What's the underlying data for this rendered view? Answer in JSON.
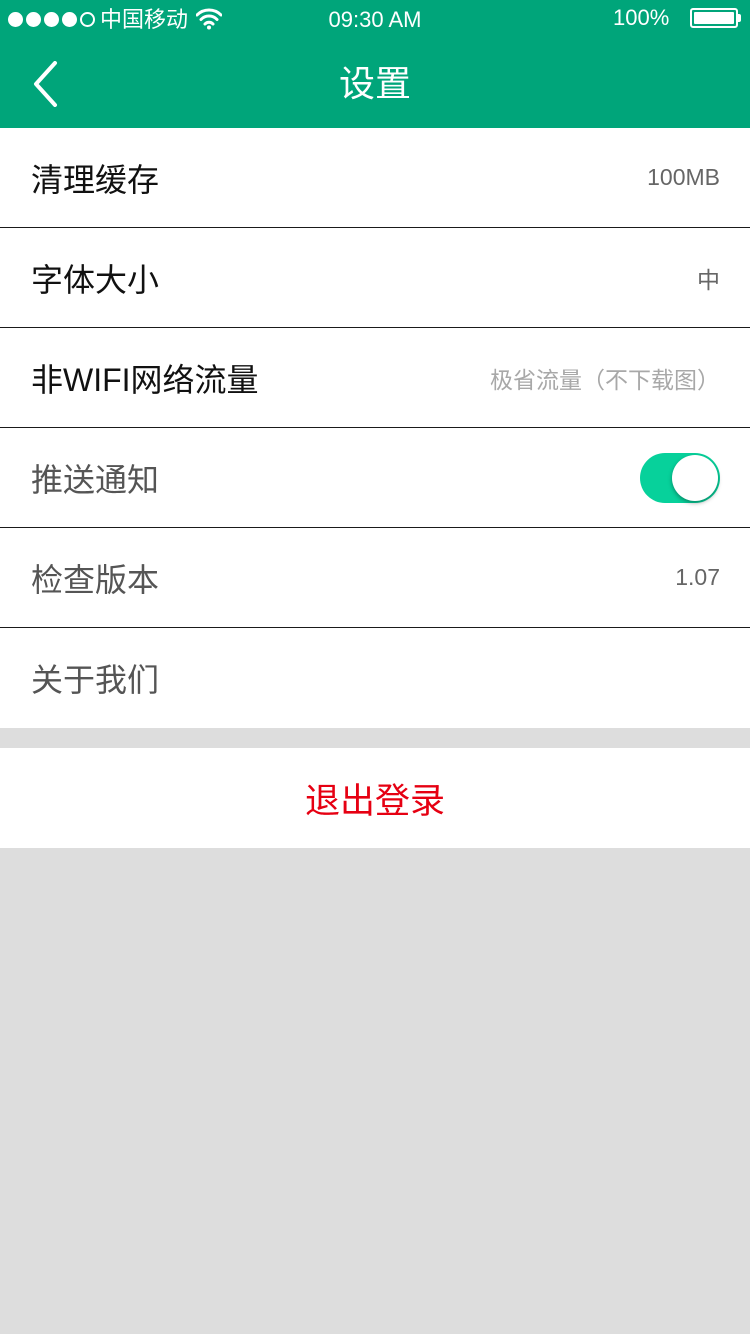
{
  "status_bar": {
    "carrier": "中国移动",
    "time": "09:30 AM",
    "battery": "100%",
    "signal_strength": 4,
    "signal_max": 5
  },
  "nav": {
    "title": "设置",
    "back_icon": "chevron-left-icon"
  },
  "settings": [
    {
      "label": "清理缓存",
      "value": "100MB"
    },
    {
      "label": "字体大小",
      "value": "中"
    },
    {
      "label": "非WIFI网络流量",
      "value": "极省流量（不下载图）"
    },
    {
      "label": "推送通知",
      "toggle_on": true
    },
    {
      "label": "检查版本",
      "value": "1.07"
    },
    {
      "label": "关于我们"
    }
  ],
  "logout": {
    "label": "退出登录"
  },
  "colors": {
    "brand": "#00a57a",
    "toggle_on": "#07d19b",
    "logout_text": "#e60012",
    "background": "#dddddd"
  }
}
